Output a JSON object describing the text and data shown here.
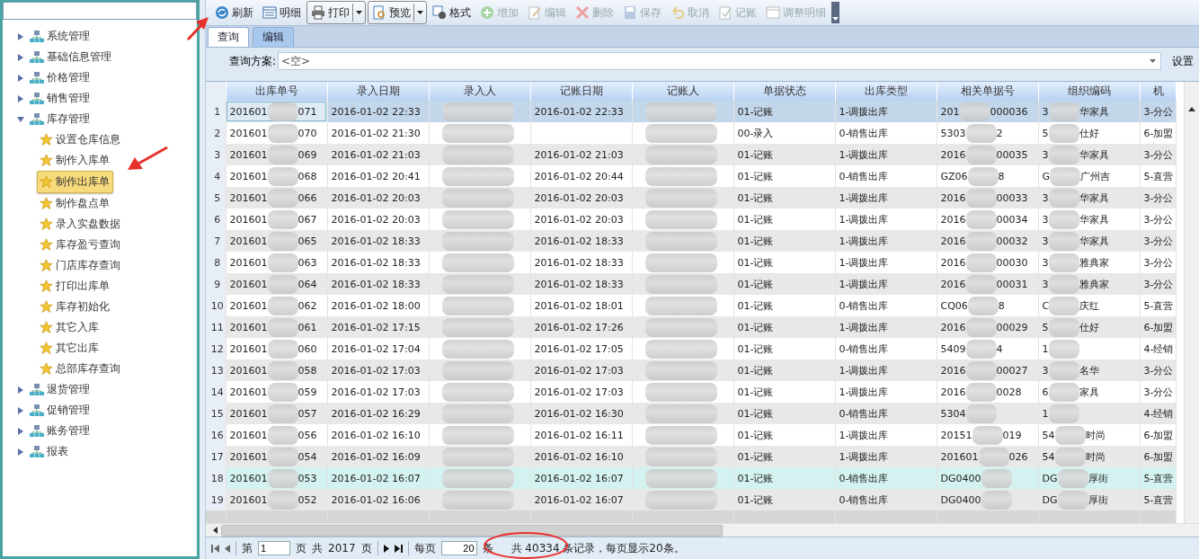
{
  "sidebar": {
    "tree": [
      {
        "label": "系统管理",
        "expanded": false
      },
      {
        "label": "基础信息管理",
        "expanded": false
      },
      {
        "label": "价格管理",
        "expanded": false
      },
      {
        "label": "销售管理",
        "expanded": false
      },
      {
        "label": "库存管理",
        "expanded": true,
        "children": [
          {
            "label": "设置仓库信息",
            "selected": false
          },
          {
            "label": "制作入库单",
            "selected": false
          },
          {
            "label": "制作出库单",
            "selected": true
          },
          {
            "label": "制作盘点单",
            "selected": false
          },
          {
            "label": "录入实盘数据",
            "selected": false
          },
          {
            "label": "库存盈亏查询",
            "selected": false
          },
          {
            "label": "门店库存查询",
            "selected": false
          },
          {
            "label": "打印出库单",
            "selected": false
          },
          {
            "label": "库存初始化",
            "selected": false
          },
          {
            "label": "其它入库",
            "selected": false
          },
          {
            "label": "其它出库",
            "selected": false
          },
          {
            "label": "总部库存查询",
            "selected": false
          }
        ]
      },
      {
        "label": "退货管理",
        "expanded": false
      },
      {
        "label": "促销管理",
        "expanded": false
      },
      {
        "label": "账务管理",
        "expanded": false
      },
      {
        "label": "报表",
        "expanded": false
      }
    ]
  },
  "toolbar": [
    {
      "label": "刷新",
      "kind": "refresh",
      "disabled": false
    },
    {
      "label": "明细",
      "kind": "detail",
      "disabled": false
    },
    {
      "label": "打印",
      "kind": "print",
      "disabled": false,
      "split": true
    },
    {
      "label": "预览",
      "kind": "preview",
      "disabled": false,
      "split": true
    },
    {
      "label": "格式",
      "kind": "format",
      "disabled": false
    },
    {
      "label": "增加",
      "kind": "add",
      "disabled": true
    },
    {
      "label": "编辑",
      "kind": "edit",
      "disabled": true
    },
    {
      "label": "删除",
      "kind": "delete",
      "disabled": true
    },
    {
      "label": "保存",
      "kind": "save",
      "disabled": true
    },
    {
      "label": "取消",
      "kind": "undo",
      "disabled": true
    },
    {
      "label": "记账",
      "kind": "post",
      "disabled": true
    },
    {
      "label": "调整明细",
      "kind": "window",
      "disabled": true
    }
  ],
  "tabs": [
    {
      "label": "查询",
      "selected": true
    },
    {
      "label": "编辑",
      "selected": false
    }
  ],
  "query": {
    "label": "查询方案:",
    "value": "<空>",
    "settings": "设置"
  },
  "table": {
    "columns": [
      {
        "title": "出库单号",
        "kind": "partial"
      },
      {
        "title": "录入日期",
        "kind": "text"
      },
      {
        "title": "录入人",
        "kind": "redacted"
      },
      {
        "title": "记账日期",
        "kind": "text"
      },
      {
        "title": "记账人",
        "kind": "redacted"
      },
      {
        "title": "单据状态",
        "kind": "text"
      },
      {
        "title": "出库类型",
        "kind": "text"
      },
      {
        "title": "相关单据号",
        "kind": "partial"
      },
      {
        "title": "组织编码",
        "kind": "partial"
      },
      {
        "title": "机",
        "kind": "text"
      }
    ],
    "rows": [
      {
        "index": "1",
        "selected": true,
        "highlighted": false,
        "cells": [
          {
            "start": "201601",
            "end": "071"
          },
          "2016-01-02 22:33",
          "",
          "2016-01-02 22:33",
          "",
          "01-记账",
          "1-调拨出库",
          {
            "start": "201",
            "end": "000036"
          },
          {
            "start": "3",
            "end": "华家具"
          },
          "3-分公"
        ]
      },
      {
        "index": "2",
        "selected": false,
        "highlighted": false,
        "cells": [
          {
            "start": "201601",
            "end": "070"
          },
          "2016-01-02 21:30",
          "",
          "",
          "",
          "00-录入",
          "0-销售出库",
          {
            "start": "5303",
            "end": "2"
          },
          {
            "start": "5",
            "end": "仕好"
          },
          "6-加盟"
        ]
      },
      {
        "index": "3",
        "selected": false,
        "highlighted": false,
        "cells": [
          {
            "start": "201601",
            "end": "069"
          },
          "2016-01-02 21:03",
          "",
          "2016-01-02 21:03",
          "",
          "01-记账",
          "1-调拨出库",
          {
            "start": "2016",
            "end": "00035"
          },
          {
            "start": "3",
            "end": "华家具"
          },
          "3-分公"
        ]
      },
      {
        "index": "4",
        "selected": false,
        "highlighted": false,
        "cells": [
          {
            "start": "201601",
            "end": "068"
          },
          "2016-01-02 20:41",
          "",
          "2016-01-02 20:44",
          "",
          "01-记账",
          "0-销售出库",
          {
            "start": "GZ06",
            "end": "8"
          },
          {
            "start": "G",
            "end": "广州吉"
          },
          "5-直营"
        ]
      },
      {
        "index": "5",
        "selected": false,
        "highlighted": false,
        "cells": [
          {
            "start": "201601",
            "end": "066"
          },
          "2016-01-02 20:03",
          "",
          "2016-01-02 20:03",
          "",
          "01-记账",
          "1-调拨出库",
          {
            "start": "2016",
            "end": "00033"
          },
          {
            "start": "3",
            "end": "华家具"
          },
          "3-分公"
        ]
      },
      {
        "index": "6",
        "selected": false,
        "highlighted": false,
        "cells": [
          {
            "start": "201601",
            "end": "067"
          },
          "2016-01-02 20:03",
          "",
          "2016-01-02 20:03",
          "",
          "01-记账",
          "1-调拨出库",
          {
            "start": "2016",
            "end": "00034"
          },
          {
            "start": "3",
            "end": "华家具"
          },
          "3-分公"
        ]
      },
      {
        "index": "7",
        "selected": false,
        "highlighted": false,
        "cells": [
          {
            "start": "201601",
            "end": "065"
          },
          "2016-01-02 18:33",
          "",
          "2016-01-02 18:33",
          "",
          "01-记账",
          "1-调拨出库",
          {
            "start": "2016",
            "end": "00032"
          },
          {
            "start": "3",
            "end": "华家具"
          },
          "3-分公"
        ]
      },
      {
        "index": "8",
        "selected": false,
        "highlighted": false,
        "cells": [
          {
            "start": "201601",
            "end": "063"
          },
          "2016-01-02 18:33",
          "",
          "2016-01-02 18:33",
          "",
          "01-记账",
          "1-调拨出库",
          {
            "start": "2016",
            "end": "00030"
          },
          {
            "start": "3",
            "end": "雅典家"
          },
          "3-分公"
        ]
      },
      {
        "index": "9",
        "selected": false,
        "highlighted": false,
        "cells": [
          {
            "start": "201601",
            "end": "064"
          },
          "2016-01-02 18:33",
          "",
          "2016-01-02 18:33",
          "",
          "01-记账",
          "1-调拨出库",
          {
            "start": "2016",
            "end": "00031"
          },
          {
            "start": "3",
            "end": "雅典家"
          },
          "3-分公"
        ]
      },
      {
        "index": "10",
        "selected": false,
        "highlighted": false,
        "cells": [
          {
            "start": "201601",
            "end": "062"
          },
          "2016-01-02 18:00",
          "",
          "2016-01-02 18:01",
          "",
          "01-记账",
          "0-销售出库",
          {
            "start": "CQ06",
            "end": "8"
          },
          {
            "start": "C",
            "end": "庆红"
          },
          "5-直营"
        ]
      },
      {
        "index": "11",
        "selected": false,
        "highlighted": false,
        "cells": [
          {
            "start": "201601",
            "end": "061"
          },
          "2016-01-02 17:15",
          "",
          "2016-01-02 17:26",
          "",
          "01-记账",
          "1-调拨出库",
          {
            "start": "2016",
            "end": "00029"
          },
          {
            "start": "5",
            "end": "仕好"
          },
          "6-加盟"
        ]
      },
      {
        "index": "12",
        "selected": false,
        "highlighted": false,
        "cells": [
          {
            "start": "201601",
            "end": "060"
          },
          "2016-01-02 17:04",
          "",
          "2016-01-02 17:05",
          "",
          "01-记账",
          "0-销售出库",
          {
            "start": "5409",
            "end": "4"
          },
          {
            "start": "1"
          },
          "4-经销"
        ]
      },
      {
        "index": "13",
        "selected": false,
        "highlighted": false,
        "cells": [
          {
            "start": "201601",
            "end": "058"
          },
          "2016-01-02 17:03",
          "",
          "2016-01-02 17:03",
          "",
          "01-记账",
          "1-调拨出库",
          {
            "start": "2016",
            "end": "00027"
          },
          {
            "start": "3",
            "end": "名华"
          },
          "3-分公"
        ]
      },
      {
        "index": "14",
        "selected": false,
        "highlighted": false,
        "cells": [
          {
            "start": "201601",
            "end": "059"
          },
          "2016-01-02 17:03",
          "",
          "2016-01-02 17:03",
          "",
          "01-记账",
          "1-调拨出库",
          {
            "start": "2016",
            "end": "0028"
          },
          {
            "start": "6",
            "end": "家具"
          },
          "3-分公"
        ]
      },
      {
        "index": "15",
        "selected": false,
        "highlighted": false,
        "cells": [
          {
            "start": "201601",
            "end": "057"
          },
          "2016-01-02 16:29",
          "",
          "2016-01-02 16:30",
          "",
          "01-记账",
          "0-销售出库",
          {
            "start": "5304"
          },
          {
            "start": "1"
          },
          "4-经销"
        ]
      },
      {
        "index": "16",
        "selected": false,
        "highlighted": false,
        "cells": [
          {
            "start": "201601",
            "end": "056"
          },
          "2016-01-02 16:10",
          "",
          "2016-01-02 16:11",
          "",
          "01-记账",
          "1-调拨出库",
          {
            "start": "20151",
            "end": "019"
          },
          {
            "start": "54",
            "end": "时尚"
          },
          "6-加盟"
        ]
      },
      {
        "index": "17",
        "selected": false,
        "highlighted": false,
        "cells": [
          {
            "start": "201601",
            "end": "054"
          },
          "2016-01-02 16:09",
          "",
          "2016-01-02 16:10",
          "",
          "01-记账",
          "1-调拨出库",
          {
            "start": "201601",
            "end": "026"
          },
          {
            "start": "54",
            "end": "时尚"
          },
          "6-加盟"
        ]
      },
      {
        "index": "18",
        "selected": false,
        "highlighted": true,
        "cells": [
          {
            "start": "201601",
            "end": "053"
          },
          "2016-01-02 16:07",
          "",
          "2016-01-02 16:07",
          "",
          "01-记账",
          "0-销售出库",
          {
            "start": "DG0400"
          },
          {
            "start": "DG",
            "end": "厚街"
          },
          "5-直营"
        ]
      },
      {
        "index": "19",
        "selected": false,
        "highlighted": false,
        "cells": [
          {
            "start": "201601",
            "end": "052"
          },
          "2016-01-02 16:06",
          "",
          "2016-01-02 16:07",
          "",
          "01-记账",
          "0-销售出库",
          {
            "start": "DG0400"
          },
          {
            "start": "DG",
            "end": "厚街"
          },
          "5-直营"
        ]
      }
    ]
  },
  "pager": {
    "page_prefix": "第",
    "page": "1",
    "page_suffix": "页",
    "total_prefix": "共",
    "total_pages": "2017",
    "total_suffix": "页",
    "per_page_prefix": "每页",
    "per_page": "20",
    "per_page_suffix": "条",
    "summary": "共 40334 条记录，每页显示20条。"
  }
}
